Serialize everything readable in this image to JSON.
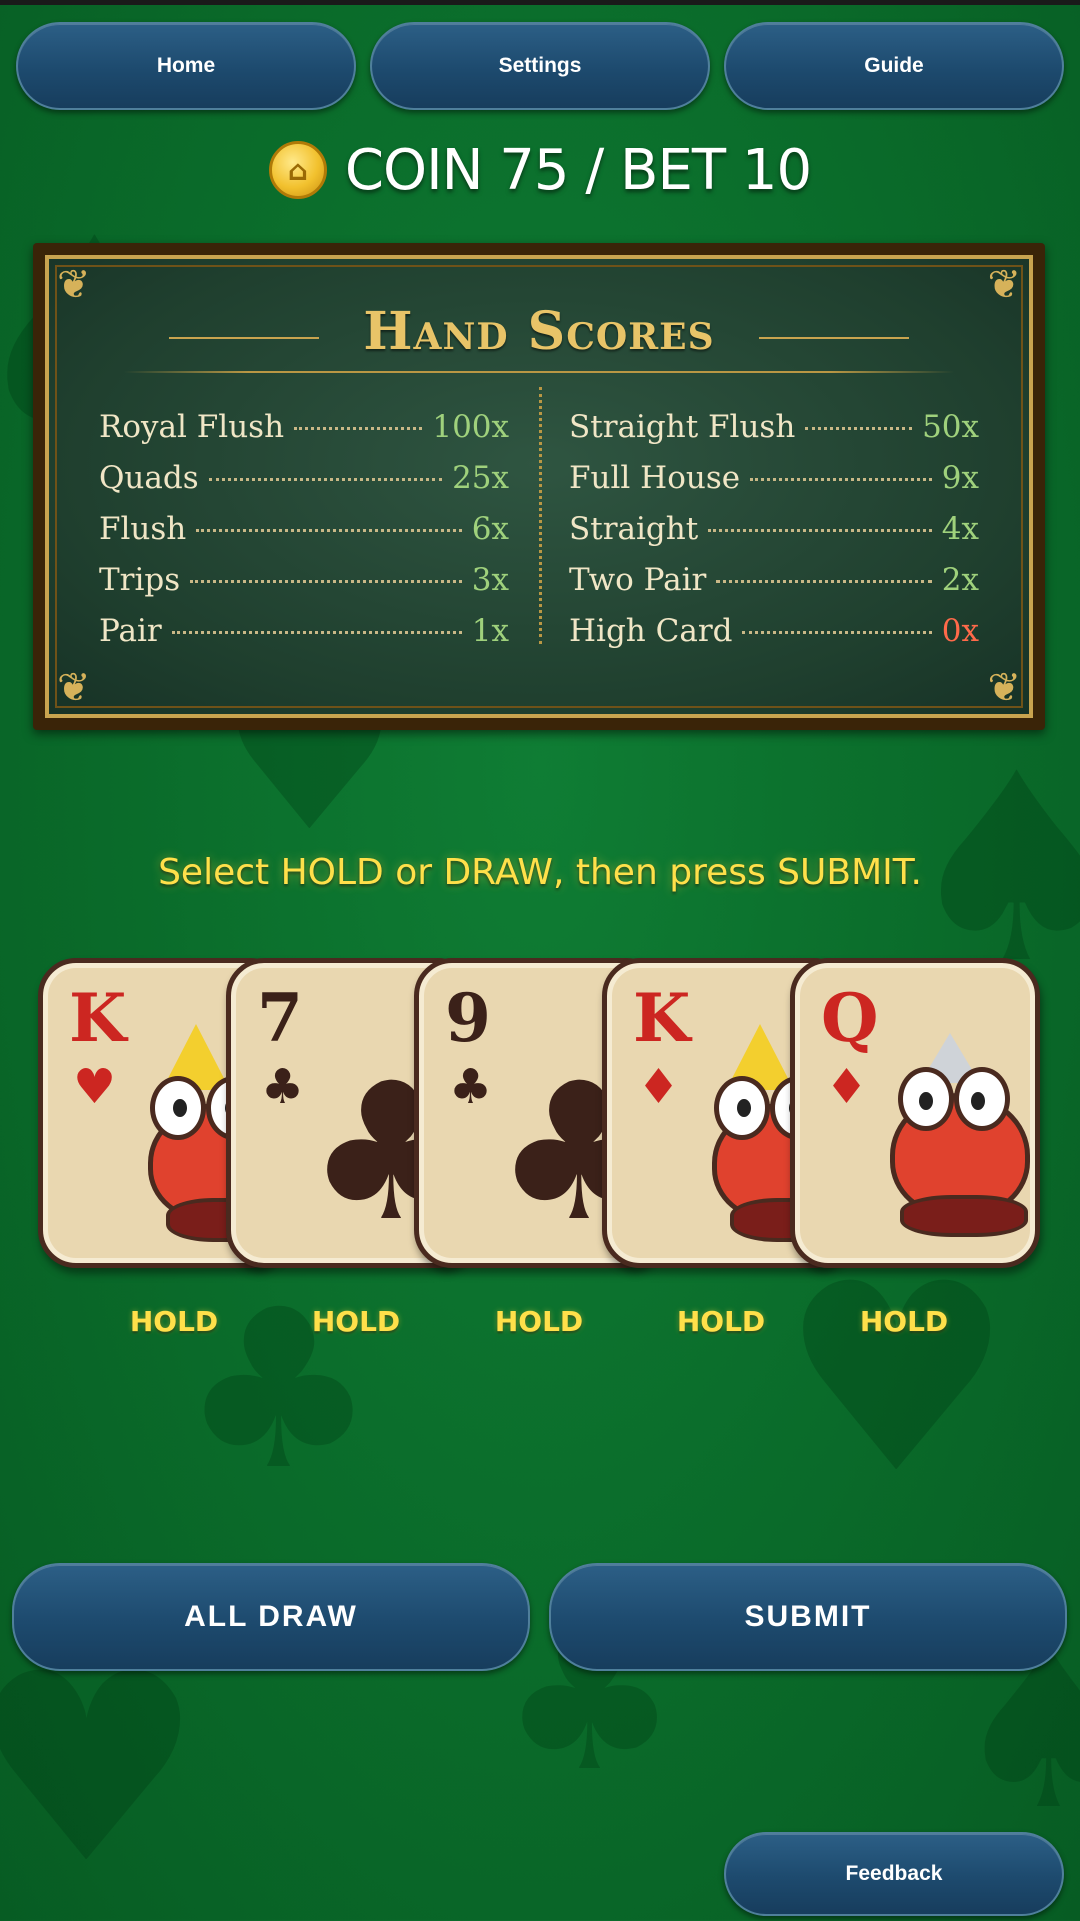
{
  "nav": {
    "home": "Home",
    "settings": "Settings",
    "guide": "Guide"
  },
  "status": {
    "text": "COIN 75 / BET 10",
    "coin_icon": "coin-icon"
  },
  "score_table": {
    "title": "Hand Scores",
    "left": [
      {
        "hand": "Royal Flush",
        "mult": "100x"
      },
      {
        "hand": "Quads",
        "mult": "25x"
      },
      {
        "hand": "Flush",
        "mult": "6x"
      },
      {
        "hand": "Trips",
        "mult": "3x"
      },
      {
        "hand": "Pair",
        "mult": "1x"
      }
    ],
    "right": [
      {
        "hand": "Straight Flush",
        "mult": "50x"
      },
      {
        "hand": "Full House",
        "mult": "9x"
      },
      {
        "hand": "Straight",
        "mult": "4x"
      },
      {
        "hand": "Two Pair",
        "mult": "2x"
      },
      {
        "hand": "High Card",
        "mult": "0x"
      }
    ]
  },
  "instruction": "Select HOLD or DRAW, then press SUBMIT.",
  "cards": [
    {
      "rank": "K",
      "suit": "♥",
      "color": "#cc2621"
    },
    {
      "rank": "7",
      "suit": "♣",
      "color": "#3b2119"
    },
    {
      "rank": "9",
      "suit": "♣",
      "color": "#3b2119"
    },
    {
      "rank": "K",
      "suit": "♦",
      "color": "#cc2621"
    },
    {
      "rank": "Q",
      "suit": "♦",
      "color": "#cc2621"
    }
  ],
  "hold_labels": [
    "HOLD",
    "HOLD",
    "HOLD",
    "HOLD",
    "HOLD"
  ],
  "buttons": {
    "all_draw": "ALL DRAW",
    "submit": "SUBMIT",
    "feedback": "Feedback"
  },
  "colors": {
    "felt": "#0a6b2a",
    "button": "#1d4a6e",
    "highlight": "#ffe04a",
    "zero_mult": "#ff6a4a"
  }
}
